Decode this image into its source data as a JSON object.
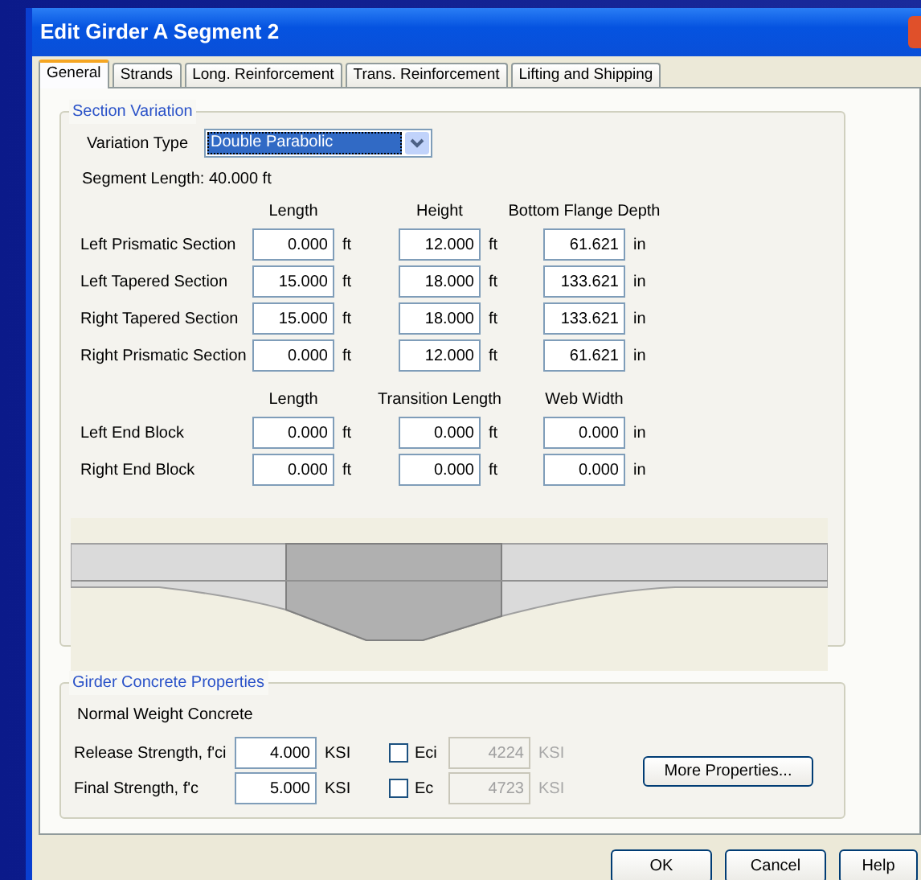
{
  "window": {
    "title": "Edit Girder A Segment 2"
  },
  "tabs": [
    {
      "label": "General",
      "selected": true
    },
    {
      "label": "Strands",
      "selected": false
    },
    {
      "label": "Long. Reinforcement",
      "selected": false
    },
    {
      "label": "Trans. Reinforcement",
      "selected": false
    },
    {
      "label": "Lifting and Shipping",
      "selected": false
    }
  ],
  "section_variation": {
    "title": "Section Variation",
    "variation_type": {
      "label": "Variation Type",
      "value": "Double Parabolic"
    },
    "segment_length": "Segment Length: 40.000 ft",
    "columns": [
      "Length",
      "Height",
      "Bottom Flange Depth"
    ],
    "rows": [
      {
        "label": "Left Prismatic Section",
        "values": [
          {
            "value": "0.000",
            "unit": "ft"
          },
          {
            "value": "12.000",
            "unit": "ft"
          },
          {
            "value": "61.621",
            "unit": "in"
          }
        ]
      },
      {
        "label": "Left Tapered Section",
        "values": [
          {
            "value": "15.000",
            "unit": "ft"
          },
          {
            "value": "18.000",
            "unit": "ft"
          },
          {
            "value": "133.621",
            "unit": "in"
          }
        ]
      },
      {
        "label": "Right Tapered Section",
        "values": [
          {
            "value": "15.000",
            "unit": "ft"
          },
          {
            "value": "18.000",
            "unit": "ft"
          },
          {
            "value": "133.621",
            "unit": "in"
          }
        ]
      },
      {
        "label": "Right Prismatic Section",
        "values": [
          {
            "value": "0.000",
            "unit": "ft"
          },
          {
            "value": "12.000",
            "unit": "ft"
          },
          {
            "value": "61.621",
            "unit": "in"
          }
        ]
      }
    ],
    "end_block_columns": [
      "Length",
      "Transition Length",
      "Web Width"
    ],
    "end_block_rows": [
      {
        "label": "Left End Block",
        "values": [
          {
            "value": "0.000",
            "unit": "ft"
          },
          {
            "value": "0.000",
            "unit": "ft"
          },
          {
            "value": "0.000",
            "unit": "in"
          }
        ]
      },
      {
        "label": "Right End Block",
        "values": [
          {
            "value": "0.000",
            "unit": "ft"
          },
          {
            "value": "0.000",
            "unit": "ft"
          },
          {
            "value": "0.000",
            "unit": "in"
          }
        ]
      }
    ]
  },
  "concrete": {
    "title": "Girder Concrete Properties",
    "type_text": "Normal Weight Concrete",
    "rows": [
      {
        "label": "Release Strength, f'ci",
        "value": "4.000",
        "unit": "KSI",
        "check_label": "Eci",
        "checked": false,
        "modulus": "4224",
        "modulus_unit": "KSI",
        "modulus_disabled": true
      },
      {
        "label": "Final Strength, f'c",
        "value": "5.000",
        "unit": "KSI",
        "check_label": "Ec",
        "checked": false,
        "modulus": "4723",
        "modulus_unit": "KSI",
        "modulus_disabled": true
      }
    ],
    "more_button": "More Properties..."
  },
  "buttons": [
    "OK",
    "Cancel",
    "Help"
  ]
}
